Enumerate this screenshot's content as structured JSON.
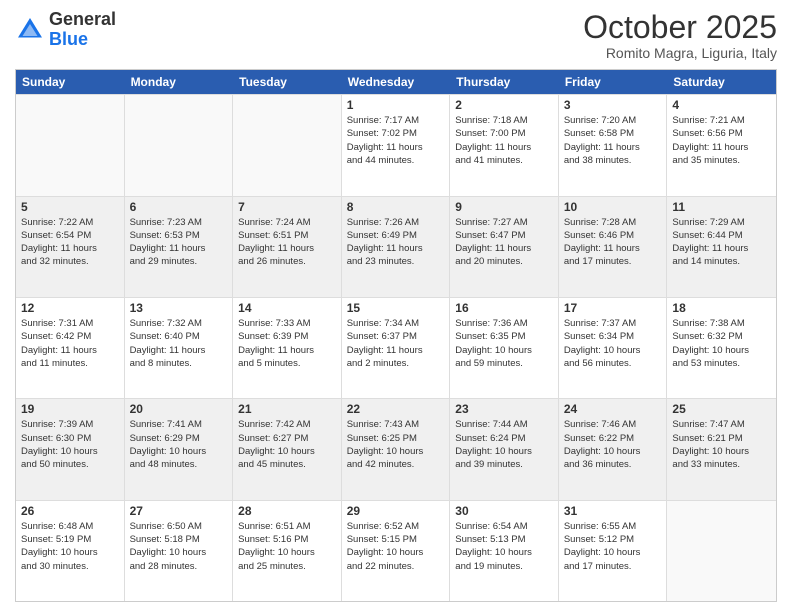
{
  "logo": {
    "general": "General",
    "blue": "Blue"
  },
  "header": {
    "month": "October 2025",
    "location": "Romito Magra, Liguria, Italy"
  },
  "weekdays": [
    "Sunday",
    "Monday",
    "Tuesday",
    "Wednesday",
    "Thursday",
    "Friday",
    "Saturday"
  ],
  "rows": [
    [
      {
        "day": "",
        "info": "",
        "empty": true
      },
      {
        "day": "",
        "info": "",
        "empty": true
      },
      {
        "day": "",
        "info": "",
        "empty": true
      },
      {
        "day": "1",
        "info": "Sunrise: 7:17 AM\nSunset: 7:02 PM\nDaylight: 11 hours\nand 44 minutes."
      },
      {
        "day": "2",
        "info": "Sunrise: 7:18 AM\nSunset: 7:00 PM\nDaylight: 11 hours\nand 41 minutes."
      },
      {
        "day": "3",
        "info": "Sunrise: 7:20 AM\nSunset: 6:58 PM\nDaylight: 11 hours\nand 38 minutes."
      },
      {
        "day": "4",
        "info": "Sunrise: 7:21 AM\nSunset: 6:56 PM\nDaylight: 11 hours\nand 35 minutes."
      }
    ],
    [
      {
        "day": "5",
        "info": "Sunrise: 7:22 AM\nSunset: 6:54 PM\nDaylight: 11 hours\nand 32 minutes."
      },
      {
        "day": "6",
        "info": "Sunrise: 7:23 AM\nSunset: 6:53 PM\nDaylight: 11 hours\nand 29 minutes."
      },
      {
        "day": "7",
        "info": "Sunrise: 7:24 AM\nSunset: 6:51 PM\nDaylight: 11 hours\nand 26 minutes."
      },
      {
        "day": "8",
        "info": "Sunrise: 7:26 AM\nSunset: 6:49 PM\nDaylight: 11 hours\nand 23 minutes."
      },
      {
        "day": "9",
        "info": "Sunrise: 7:27 AM\nSunset: 6:47 PM\nDaylight: 11 hours\nand 20 minutes."
      },
      {
        "day": "10",
        "info": "Sunrise: 7:28 AM\nSunset: 6:46 PM\nDaylight: 11 hours\nand 17 minutes."
      },
      {
        "day": "11",
        "info": "Sunrise: 7:29 AM\nSunset: 6:44 PM\nDaylight: 11 hours\nand 14 minutes."
      }
    ],
    [
      {
        "day": "12",
        "info": "Sunrise: 7:31 AM\nSunset: 6:42 PM\nDaylight: 11 hours\nand 11 minutes."
      },
      {
        "day": "13",
        "info": "Sunrise: 7:32 AM\nSunset: 6:40 PM\nDaylight: 11 hours\nand 8 minutes."
      },
      {
        "day": "14",
        "info": "Sunrise: 7:33 AM\nSunset: 6:39 PM\nDaylight: 11 hours\nand 5 minutes."
      },
      {
        "day": "15",
        "info": "Sunrise: 7:34 AM\nSunset: 6:37 PM\nDaylight: 11 hours\nand 2 minutes."
      },
      {
        "day": "16",
        "info": "Sunrise: 7:36 AM\nSunset: 6:35 PM\nDaylight: 10 hours\nand 59 minutes."
      },
      {
        "day": "17",
        "info": "Sunrise: 7:37 AM\nSunset: 6:34 PM\nDaylight: 10 hours\nand 56 minutes."
      },
      {
        "day": "18",
        "info": "Sunrise: 7:38 AM\nSunset: 6:32 PM\nDaylight: 10 hours\nand 53 minutes."
      }
    ],
    [
      {
        "day": "19",
        "info": "Sunrise: 7:39 AM\nSunset: 6:30 PM\nDaylight: 10 hours\nand 50 minutes."
      },
      {
        "day": "20",
        "info": "Sunrise: 7:41 AM\nSunset: 6:29 PM\nDaylight: 10 hours\nand 48 minutes."
      },
      {
        "day": "21",
        "info": "Sunrise: 7:42 AM\nSunset: 6:27 PM\nDaylight: 10 hours\nand 45 minutes."
      },
      {
        "day": "22",
        "info": "Sunrise: 7:43 AM\nSunset: 6:25 PM\nDaylight: 10 hours\nand 42 minutes."
      },
      {
        "day": "23",
        "info": "Sunrise: 7:44 AM\nSunset: 6:24 PM\nDaylight: 10 hours\nand 39 minutes."
      },
      {
        "day": "24",
        "info": "Sunrise: 7:46 AM\nSunset: 6:22 PM\nDaylight: 10 hours\nand 36 minutes."
      },
      {
        "day": "25",
        "info": "Sunrise: 7:47 AM\nSunset: 6:21 PM\nDaylight: 10 hours\nand 33 minutes."
      }
    ],
    [
      {
        "day": "26",
        "info": "Sunrise: 6:48 AM\nSunset: 5:19 PM\nDaylight: 10 hours\nand 30 minutes."
      },
      {
        "day": "27",
        "info": "Sunrise: 6:50 AM\nSunset: 5:18 PM\nDaylight: 10 hours\nand 28 minutes."
      },
      {
        "day": "28",
        "info": "Sunrise: 6:51 AM\nSunset: 5:16 PM\nDaylight: 10 hours\nand 25 minutes."
      },
      {
        "day": "29",
        "info": "Sunrise: 6:52 AM\nSunset: 5:15 PM\nDaylight: 10 hours\nand 22 minutes."
      },
      {
        "day": "30",
        "info": "Sunrise: 6:54 AM\nSunset: 5:13 PM\nDaylight: 10 hours\nand 19 minutes."
      },
      {
        "day": "31",
        "info": "Sunrise: 6:55 AM\nSunset: 5:12 PM\nDaylight: 10 hours\nand 17 minutes."
      },
      {
        "day": "",
        "info": "",
        "empty": true
      }
    ]
  ]
}
